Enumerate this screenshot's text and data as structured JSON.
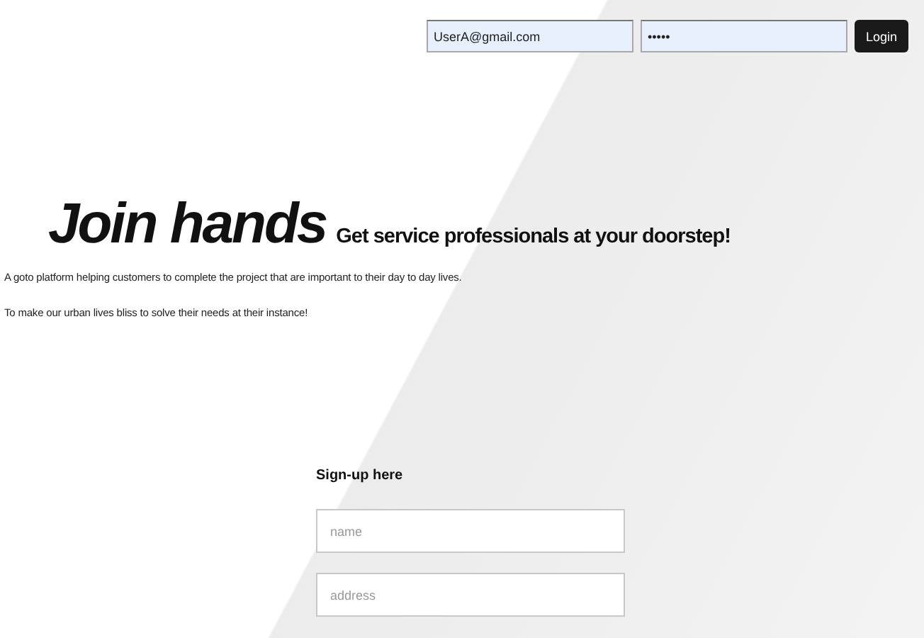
{
  "login": {
    "email": "UserA@gmail.com",
    "password": "•••••",
    "button": "Login"
  },
  "hero": {
    "title": "Join hands",
    "tagline": "Get service professionals at your doorstep!",
    "paragraphs": [
      "A goto platform helping customers to complete the project that are important to their day to day lives.",
      "To make our urban lives bliss to solve their needs at their instance!"
    ]
  },
  "signup": {
    "heading": "Sign-up here",
    "fields": [
      {
        "placeholder": "name"
      },
      {
        "placeholder": "address"
      }
    ]
  }
}
